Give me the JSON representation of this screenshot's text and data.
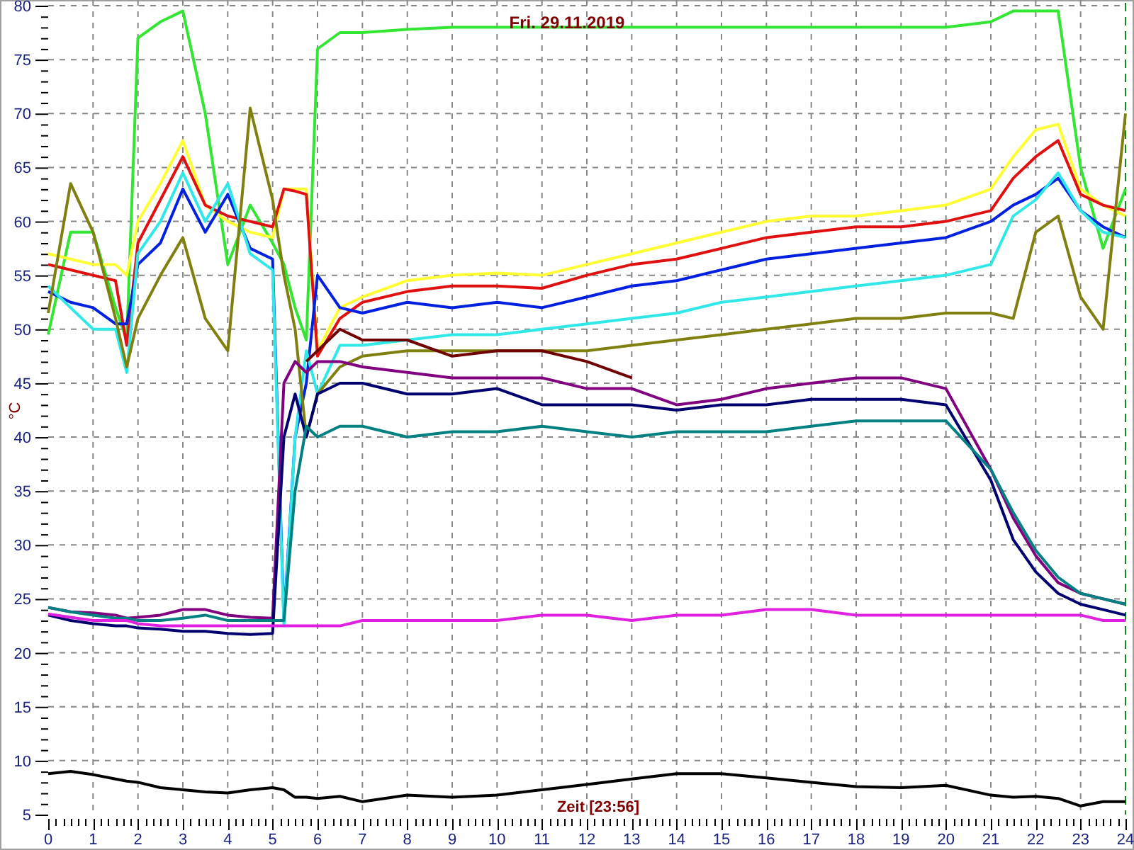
{
  "chart": {
    "chart_data": {
      "type": "line",
      "title": "Fri. 29.11.2019",
      "xlabel": "Zeit [23:56]",
      "ylabel": "°C",
      "x": [
        0,
        0.5,
        1,
        1.5,
        1.75,
        2,
        2.5,
        3,
        3.5,
        4,
        4.5,
        5,
        5.25,
        5.5,
        5.75,
        6,
        6.5,
        7,
        8,
        9,
        10,
        11,
        12,
        13,
        14,
        15,
        16,
        17,
        18,
        19,
        20,
        21,
        21.5,
        22,
        22.5,
        23,
        23.5,
        24
      ],
      "series": [
        {
          "color": "#33e633",
          "values": [
            49.5,
            59,
            59,
            52,
            49,
            77,
            78.5,
            79.5,
            70,
            56,
            61.5,
            58,
            56,
            52,
            49,
            76,
            77.5,
            77.5,
            77.8,
            78,
            78,
            78,
            78,
            78,
            78,
            78,
            78,
            78,
            78,
            78,
            78,
            78.5,
            79.5,
            79.5,
            79.5,
            65,
            57.5,
            63
          ]
        },
        {
          "color": "#ffff33",
          "values": [
            57,
            56.5,
            56,
            56,
            55,
            60,
            63.5,
            67.5,
            61.5,
            60,
            59,
            58.5,
            63,
            63,
            63,
            48,
            52,
            53,
            54.5,
            55,
            55.2,
            55,
            56,
            57,
            58,
            59,
            60,
            60.5,
            60.5,
            61,
            61.5,
            63,
            66,
            68.5,
            69,
            63,
            61.5,
            60.5
          ]
        },
        {
          "color": "#e01010",
          "values": [
            56,
            55.5,
            55,
            54.5,
            48.5,
            58,
            62,
            66,
            61.5,
            60.5,
            60,
            59.5,
            63,
            62.8,
            62.5,
            47.5,
            51,
            52.5,
            53.5,
            54,
            54,
            53.8,
            55,
            56,
            56.5,
            57.5,
            58.5,
            59,
            59.5,
            59.5,
            60,
            61,
            64,
            66,
            67.5,
            62.5,
            61.5,
            61
          ]
        },
        {
          "color": "#0020e0",
          "values": [
            53.5,
            52.5,
            52,
            50.5,
            50.5,
            56,
            58,
            63,
            59,
            62.5,
            57.5,
            56.5,
            23,
            40,
            45,
            55,
            52,
            51.5,
            52.5,
            52,
            52.5,
            52,
            53,
            54,
            54.5,
            55.5,
            56.5,
            57,
            57.5,
            58,
            58.5,
            60,
            61.5,
            62.5,
            64,
            61,
            59.5,
            58.5
          ]
        },
        {
          "color": "#30e8e8",
          "values": [
            54,
            52,
            50,
            50,
            46,
            57,
            60,
            64.5,
            60,
            63.5,
            57,
            55.5,
            22.5,
            40,
            48,
            44,
            48.5,
            48.5,
            49,
            49.5,
            49.5,
            50,
            50.5,
            51,
            51.5,
            52.5,
            53,
            53.5,
            54,
            54.5,
            55,
            56,
            60.5,
            62,
            64.5,
            61,
            59,
            58.5
          ]
        },
        {
          "color": "#808010",
          "values": [
            51.5,
            63.5,
            59,
            51,
            46.5,
            51,
            55,
            58.5,
            51,
            48,
            70.5,
            62,
            55,
            50,
            40,
            44,
            46.5,
            47.5,
            48,
            48,
            48,
            48,
            48,
            48.5,
            49,
            49.5,
            50,
            50.5,
            51,
            51,
            51.5,
            51.5,
            51,
            59,
            60.5,
            53,
            50,
            70
          ]
        },
        {
          "color": "#700000",
          "values": [
            null,
            null,
            null,
            null,
            null,
            null,
            null,
            null,
            null,
            null,
            null,
            null,
            null,
            null,
            47,
            48,
            50,
            49,
            49,
            47.5,
            48,
            48,
            47,
            45.5,
            null,
            null,
            null,
            null,
            null,
            null,
            null,
            null,
            null,
            null,
            null,
            null,
            null,
            null
          ]
        },
        {
          "color": "#800080",
          "values": [
            24.2,
            23.8,
            23.7,
            23.5,
            23.2,
            23.3,
            23.5,
            24,
            24,
            23.5,
            23.3,
            23.2,
            45,
            47,
            46,
            47,
            47,
            46.5,
            46,
            45.5,
            45.5,
            45.5,
            44.5,
            44.5,
            43,
            43.5,
            44.5,
            45,
            45.5,
            45.5,
            44.5,
            37,
            32.5,
            29,
            26.5,
            25.5,
            25,
            24.5
          ]
        },
        {
          "color": "#000070",
          "values": [
            23.5,
            23,
            22.7,
            22.5,
            22.5,
            22.3,
            22.2,
            22,
            22,
            21.8,
            21.7,
            21.8,
            40,
            44,
            40,
            44,
            45,
            45,
            44,
            44,
            44.5,
            43,
            43,
            43,
            42.5,
            43,
            43,
            43.5,
            43.5,
            43.5,
            43,
            36,
            30.5,
            27.5,
            25.5,
            24.5,
            24,
            23.5
          ]
        },
        {
          "color": "#008080",
          "values": [
            24.2,
            23.8,
            23.5,
            23.2,
            23.2,
            23,
            23,
            23.2,
            23.5,
            23,
            23,
            23,
            23,
            35,
            41,
            40,
            41,
            41,
            40,
            40.5,
            40.5,
            41,
            40.5,
            40,
            40.5,
            40.5,
            40.5,
            41,
            41.5,
            41.5,
            41.5,
            37,
            33,
            29.5,
            27,
            25.5,
            25,
            24.5
          ]
        },
        {
          "color": "#e020e0",
          "values": [
            23.6,
            23.3,
            23,
            23,
            23,
            22.7,
            22.5,
            22.5,
            22.5,
            22.5,
            22.5,
            22.5,
            22.5,
            22.5,
            22.5,
            22.5,
            22.5,
            23,
            23,
            23,
            23,
            23.5,
            23.5,
            23,
            23.5,
            23.5,
            24,
            24,
            23.5,
            23.5,
            23.5,
            23.5,
            23.5,
            23.5,
            23.5,
            23.5,
            23,
            23
          ]
        },
        {
          "color": "#000000",
          "values": [
            8.8,
            9,
            8.7,
            8.3,
            8.1,
            8,
            7.5,
            7.3,
            7.1,
            7,
            7.3,
            7.5,
            7.3,
            6.6,
            6.6,
            6.5,
            6.7,
            6.2,
            6.8,
            6.6,
            6.8,
            7.3,
            7.8,
            8.3,
            8.8,
            8.8,
            8.4,
            8,
            7.6,
            7.5,
            7.7,
            6.8,
            6.6,
            6.7,
            6.5,
            5.8,
            6.2,
            6.2
          ]
        }
      ],
      "xlim": [
        0,
        24
      ],
      "ylim": [
        5,
        80
      ],
      "xticks": [
        0,
        1,
        2,
        3,
        4,
        5,
        6,
        7,
        8,
        9,
        10,
        11,
        12,
        13,
        14,
        15,
        16,
        17,
        18,
        19,
        20,
        21,
        22,
        23,
        24
      ],
      "yticks": [
        5,
        10,
        15,
        20,
        25,
        30,
        35,
        40,
        45,
        50,
        55,
        60,
        65,
        70,
        75,
        80
      ],
      "grid": true
    }
  }
}
